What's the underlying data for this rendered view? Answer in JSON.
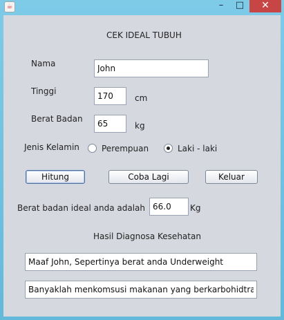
{
  "window": {
    "icon": "java-icon",
    "minimize": "–",
    "maximize": "□",
    "close": "✕"
  },
  "form": {
    "title": "CEK IDEAL TUBUH",
    "nama_label": "Nama",
    "nama_value": "John",
    "tinggi_label": "Tinggi",
    "tinggi_value": "170",
    "tinggi_unit": "cm",
    "berat_label": "Berat Badan",
    "berat_value": "65",
    "berat_unit": "kg",
    "gender_label": "Jenis Kelamin",
    "gender_options": [
      "Perempuan",
      "Laki - laki"
    ],
    "gender_selected": "Laki - laki"
  },
  "buttons": {
    "hitung": "Hitung",
    "coba_lagi": "Coba Lagi",
    "keluar": "Keluar"
  },
  "result": {
    "ideal_label": "Berat badan ideal anda adalah",
    "ideal_value": "66.0",
    "ideal_unit": "Kg",
    "diagnosa_title": "Hasil Diagnosa Kesehatan",
    "diagnosa_line1": "Maaf John, Sepertinya berat anda Underweight",
    "diagnosa_line2": "Banyaklah menkomsusi makanan yang berkarbohidtra"
  }
}
